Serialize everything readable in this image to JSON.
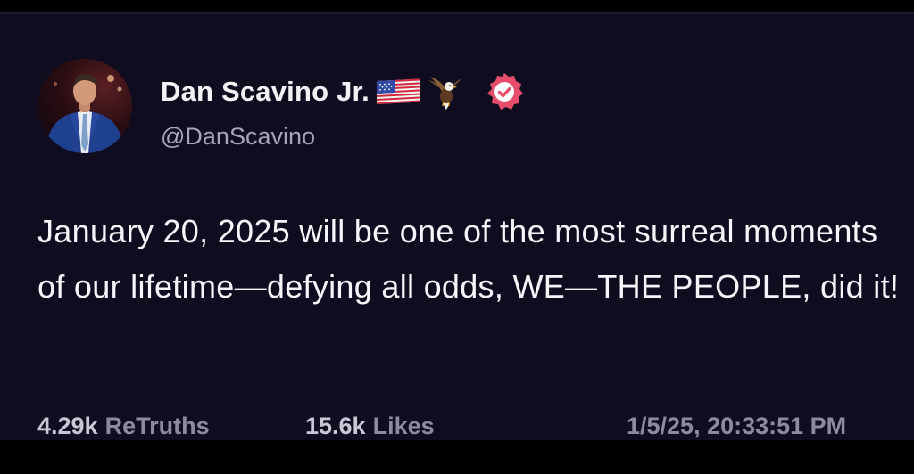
{
  "post": {
    "author": {
      "display_name": "Dan Scavino Jr.",
      "handle": "@DanScavino",
      "badges": [
        "us-flag-icon",
        "eagle-icon",
        "verified-badge-icon"
      ],
      "verified_color": "#e64d6b"
    },
    "text": "January 20, 2025 will be one of the most surreal moments of our lifetime—defying all odds, WE—THE PEOPLE, did it!",
    "stats": {
      "retruths_count": "4.29k",
      "retruths_label": "ReTruths",
      "likes_count": "15.6k",
      "likes_label": "Likes"
    },
    "timestamp": "1/5/25, 20:33:51 PM"
  },
  "colors": {
    "background": "#0f0c1f",
    "text_primary": "#f6f5fa",
    "text_secondary": "#8d89a1"
  }
}
